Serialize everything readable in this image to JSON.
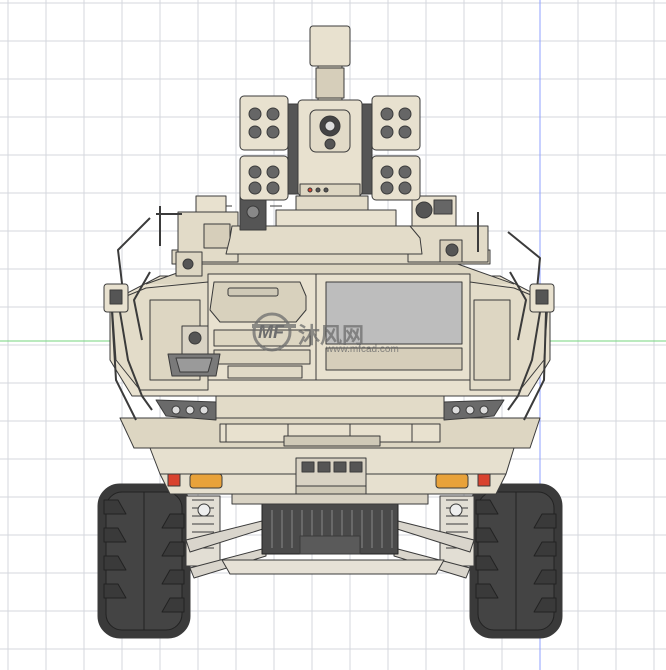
{
  "drawing": {
    "subject": "",
    "watermark": {
      "logo_letters": "MF",
      "text": "沐风网",
      "url": "www.mfcad.com"
    }
  },
  "colors": {
    "background": "#ffffff",
    "grid": "#d4d7de",
    "axis_blue": "#8fa0ff",
    "axis_green": "#74d67e",
    "body": "#e8e1cf",
    "body_shade": "#d6ceba",
    "panel": "#cfc9b7",
    "outline": "#3b3b3b",
    "tire": "#3a3a3a",
    "tire_dark": "#2a2a2a",
    "lamp": "#e8a23a",
    "red_lamp": "#d9432f",
    "window": "#bdbdbd",
    "watermark": "#6d6d6d"
  }
}
